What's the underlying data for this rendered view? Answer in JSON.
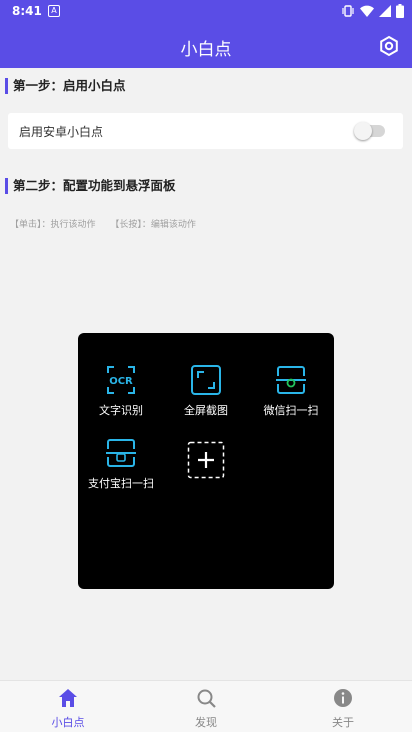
{
  "status_bar": {
    "time": "8:41",
    "notification_glyph": "A"
  },
  "app_bar": {
    "title": "小白点"
  },
  "sections": {
    "step1_title": "第一步：启用小白点",
    "enable_label": "启用安卓小白点",
    "enable_on": false,
    "step2_title": "第二步：配置功能到悬浮面板",
    "hint_tap": "【单击】：执行该动作",
    "hint_long": "【长按】：编辑该动作"
  },
  "panel": {
    "items": [
      {
        "label": "文字识别",
        "icon": "ocr-icon",
        "icon_text": "OCR"
      },
      {
        "label": "全屏截图",
        "icon": "fullscreen-screenshot-icon"
      },
      {
        "label": "微信扫一扫",
        "icon": "wechat-scan-icon"
      },
      {
        "label": "支付宝扫一扫",
        "icon": "alipay-scan-icon"
      }
    ],
    "add_icon": "add-icon"
  },
  "bottom_nav": [
    {
      "label": "小白点",
      "icon": "home-icon",
      "active": true
    },
    {
      "label": "发现",
      "icon": "search-icon",
      "active": false
    },
    {
      "label": "关于",
      "icon": "info-icon",
      "active": false
    }
  ],
  "colors": {
    "primary": "#5a4de6",
    "accent_cyan": "#2ab5e8",
    "panel_bg": "#000000"
  }
}
